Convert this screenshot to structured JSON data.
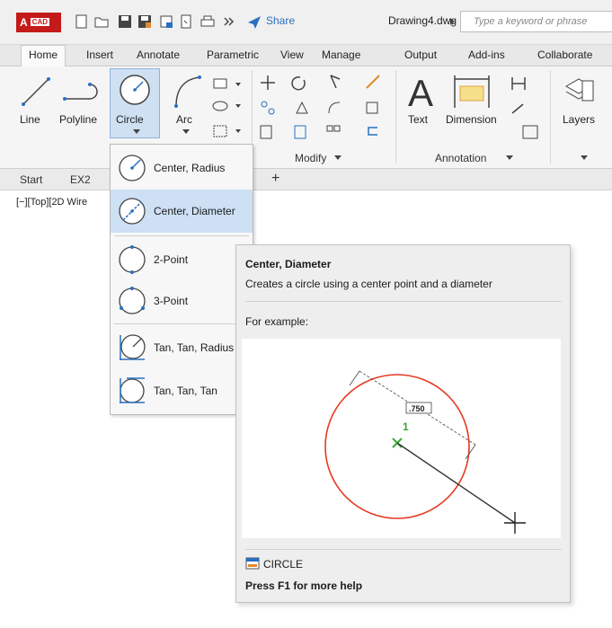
{
  "app": {
    "logo_main": "A",
    "logo_badge": "CAD",
    "share_label": "Share",
    "document_title": "Drawing4.dwg",
    "search_placeholder": "Type a keyword or phrase"
  },
  "ribbon_tabs": [
    "Home",
    "Insert",
    "Annotate",
    "Parametric",
    "View",
    "Manage",
    "Output",
    "Add-ins",
    "Collaborate"
  ],
  "ribbon": {
    "draw_tools": [
      "Line",
      "Polyline",
      "Circle",
      "Arc"
    ],
    "annotation_tools": [
      "Text",
      "Dimension"
    ],
    "layers_label": "Layers",
    "modify_panel": "Modify",
    "annotation_panel": "Annotation"
  },
  "file_tabs": [
    "Start",
    "EX2"
  ],
  "viewport_label": "[−][Top][2D Wire",
  "circle_menu": [
    {
      "label": "Center, Radius"
    },
    {
      "label": "Center, Diameter"
    },
    {
      "label": "2-Point"
    },
    {
      "label": "3-Point"
    },
    {
      "label": "Tan, Tan, Radius"
    },
    {
      "label": "Tan, Tan, Tan"
    }
  ],
  "tooltip": {
    "title": "Center, Diameter",
    "description": "Creates a circle using a center point and a diameter",
    "example_label": "For example:",
    "dimension_value": ".750",
    "point_label": "1",
    "command": "CIRCLE",
    "help_text": "Press F1 for more help"
  },
  "colors": {
    "accent": "#2a6fc0",
    "highlight": "#cde0f4",
    "example_circle": "#e63a22",
    "example_marker": "#3aa637"
  }
}
